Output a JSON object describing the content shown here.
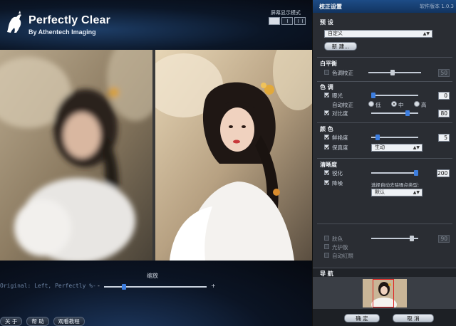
{
  "app": {
    "logo_title": "Perfectly Clear",
    "logo_subtitle": "By Athentech Imaging",
    "view_mode_label": "屏幕显示模式"
  },
  "viewer": {
    "zoom_label": "缩放",
    "original_text": "Original: Left, Perfectly %-",
    "zoom_minus": "-",
    "zoom_plus": "+",
    "zoom_level": 0.18
  },
  "bottom_buttons": [
    "关 于",
    "帮 助",
    "观看教程"
  ],
  "panel": {
    "title": "校正设置",
    "version": "软件版本 1.0.3",
    "preset": {
      "title": "预 设",
      "selected": "自定义",
      "new_button": "新 建..."
    },
    "white_balance": {
      "title": "白平衡",
      "tint_label": "色调校正",
      "tint_checked": false,
      "tint_value": "50",
      "tint_level": 0.45
    },
    "tone": {
      "title": "色 调",
      "exposure_label": "曝光",
      "exposure_checked": true,
      "exposure_value": "0",
      "exposure_level": 0.0,
      "auto_label": "自动校正",
      "auto_options": [
        "低",
        "中",
        "高"
      ],
      "auto_selected": 1,
      "contrast_label": "对比度",
      "contrast_checked": true,
      "contrast_value": "80",
      "contrast_level": 0.8
    },
    "color": {
      "title": "颜 色",
      "vibrance_label": "鲜艳度",
      "vibrance_checked": true,
      "vibrance_value": "5",
      "vibrance_level": 0.1,
      "fidelity_label": "保真度",
      "fidelity_checked": true,
      "fidelity_selected": "生动"
    },
    "sharpness": {
      "title": "清晰度",
      "sharpen_label": "锐化",
      "sharpen_checked": true,
      "sharpen_value": "200",
      "sharpen_level": 1.0,
      "noise_label": "降噪",
      "noise_checked": true,
      "noise_hint": "选择自动去除噪点类型:",
      "noise_selected": "默认"
    },
    "extras": {
      "skin_label": "肤色",
      "skin_value": "90",
      "skin_level": 0.9,
      "glare_label": "光护散",
      "redeye_label": "自动红眼"
    },
    "navigation_title": "导 航",
    "ok_button": "确 定",
    "cancel_button": "取 消"
  },
  "colors": {
    "accent": "#3d7ee0",
    "panel_header": "#1d4c86",
    "panel_bg": "#2a2d33"
  }
}
